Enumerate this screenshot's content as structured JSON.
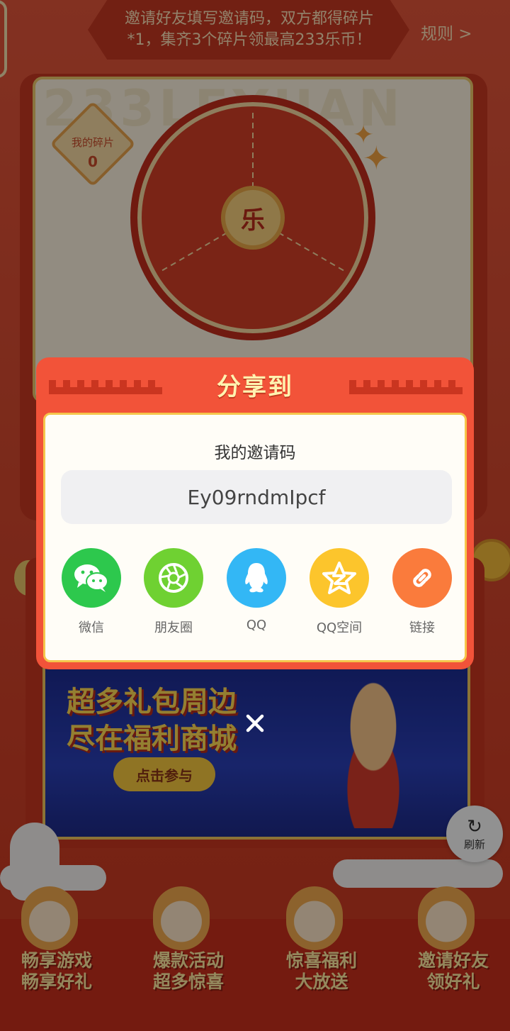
{
  "banner": {
    "invite_text_line1": "邀请好友填写邀请码，双方都得碎片",
    "invite_text_line2": "*1，集齐3个碎片领最高233乐币！",
    "rules_link": "规则 >"
  },
  "wheel": {
    "fragment_label": "我的碎片",
    "fragment_count": "0",
    "center_char": "乐"
  },
  "promo": {
    "title_line1": "超多礼包周边",
    "title_line2": "尽在福利商城",
    "button": "点击参与"
  },
  "refresh": {
    "label": "刷新"
  },
  "features": [
    {
      "line1": "畅享游戏",
      "line2": "畅享好礼"
    },
    {
      "line1": "爆款活动",
      "line2": "超多惊喜"
    },
    {
      "line1": "惊喜福利",
      "line2": "大放送"
    },
    {
      "line1": "邀请好友",
      "line2": "领好礼"
    }
  ],
  "share_modal": {
    "title": "分享到",
    "invite_code_heading": "我的邀请码",
    "invite_code": "Ey09rndmIpcf",
    "targets": [
      {
        "label": "微信",
        "icon": "wechat-icon",
        "color": "#2dc84d"
      },
      {
        "label": "朋友圈",
        "icon": "moments-icon",
        "color": "#6fd132"
      },
      {
        "label": "QQ",
        "icon": "qq-icon",
        "color": "#33b7f5"
      },
      {
        "label": "QQ空间",
        "icon": "qzone-icon",
        "color": "#fcc52c"
      },
      {
        "label": "链接",
        "icon": "link-icon",
        "color": "#fa7b3c"
      }
    ]
  }
}
